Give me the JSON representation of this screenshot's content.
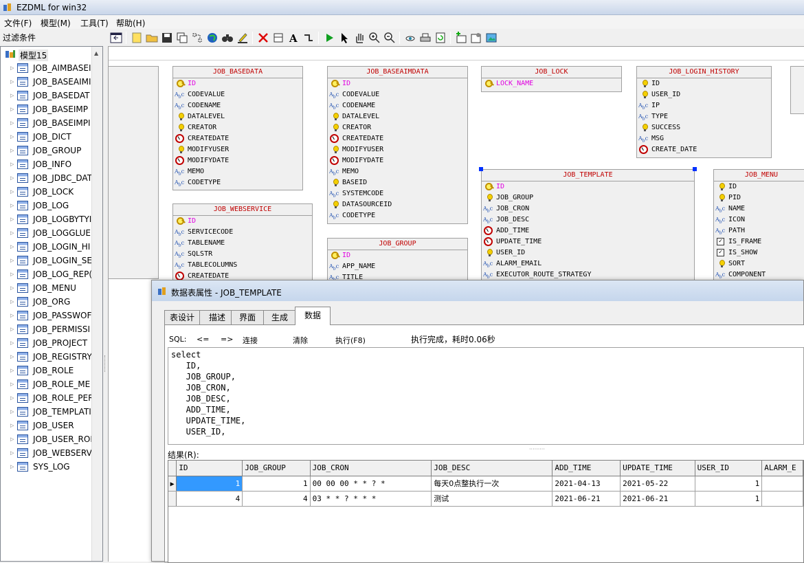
{
  "window": {
    "title": "EZDML for win32"
  },
  "menu": [
    "文件(F)",
    "模型(M)",
    "工具(T)",
    "帮助(H)"
  ],
  "sidebar": {
    "filter_label": "过滤条件",
    "root": "模型15",
    "items": [
      "JOB_AIMBASEI",
      "JOB_BASEAIMI",
      "JOB_BASEDAT",
      "JOB_BASEIMP",
      "JOB_BASEIMPI",
      "JOB_DICT",
      "JOB_GROUP",
      "JOB_INFO",
      "JOB_JDBC_DAT",
      "JOB_LOCK",
      "JOB_LOG",
      "JOB_LOGBYTYI",
      "JOB_LOGGLUE",
      "JOB_LOGIN_HI",
      "JOB_LOGIN_SE",
      "JOB_LOG_REP(",
      "JOB_MENU",
      "JOB_ORG",
      "JOB_PASSWOF",
      "JOB_PERMISSI",
      "JOB_PROJECT",
      "JOB_REGISTRY",
      "JOB_ROLE",
      "JOB_ROLE_ME",
      "JOB_ROLE_PER",
      "JOB_TEMPLATI",
      "JOB_USER",
      "JOB_USER_ROI",
      "JOB_WEBSERV",
      "SYS_LOG"
    ]
  },
  "entities": {
    "basedata": {
      "name": "JOB_BASEDATA",
      "fields": [
        "ID",
        "CODEVALUE",
        "CODENAME",
        "DATALEVEL",
        "CREATOR",
        "CREATEDATE",
        "MODIFYUSER",
        "MODIFYDATE",
        "MEMO",
        "CODETYPE"
      ]
    },
    "baseaimdata": {
      "name": "JOB_BASEAIMDATA",
      "fields": [
        "ID",
        "CODEVALUE",
        "CODENAME",
        "DATALEVEL",
        "CREATOR",
        "CREATEDATE",
        "MODIFYUSER",
        "MODIFYDATE",
        "MEMO",
        "BASEID",
        "SYSTEMCODE",
        "DATASOURCEID",
        "CODETYPE"
      ]
    },
    "lock": {
      "name": "JOB_LOCK",
      "fields": [
        "LOCK_NAME"
      ]
    },
    "login_history": {
      "name": "JOB_LOGIN_HISTORY",
      "fields": [
        "ID",
        "USER_ID",
        "IP",
        "TYPE",
        "SUCCESS",
        "MSG",
        "CREATE_DATE"
      ]
    },
    "webservice": {
      "name": "JOB_WEBSERVICE",
      "fields": [
        "ID",
        "SERVICECODE",
        "TABLENAME",
        "SQLSTR",
        "TABLECOLUMNS",
        "CREATEDATE"
      ]
    },
    "group": {
      "name": "JOB_GROUP",
      "fields": [
        "ID",
        "APP_NAME",
        "TITLE"
      ]
    },
    "template": {
      "name": "JOB_TEMPLATE",
      "fields": [
        "ID",
        "JOB_GROUP",
        "JOB_CRON",
        "JOB_DESC",
        "ADD_TIME",
        "UPDATE_TIME",
        "USER_ID",
        "ALARM_EMAIL",
        "EXECUTOR_ROUTE_STRATEGY"
      ]
    },
    "menu": {
      "name": "JOB_MENU",
      "fields": [
        "ID",
        "PID",
        "NAME",
        "ICON",
        "PATH",
        "IS_FRAME",
        "IS_SHOW",
        "SORT",
        "COMPONENT"
      ]
    }
  },
  "dialog": {
    "title": "数据表属性 - JOB_TEMPLATE",
    "tabs": [
      "表设计",
      "描述",
      "界面",
      "生成",
      "数据"
    ],
    "active_tab": "数据",
    "sql_label": "SQL:",
    "prev_label": "<=",
    "next_label": "=>",
    "connect_label": "连接",
    "clear_label": "清除",
    "execute_label": "执行(F8)",
    "status": "执行完成，耗时0.06秒",
    "sql_text": "select\n   ID,\n   JOB_GROUP,\n   JOB_CRON,\n   JOB_DESC,\n   ADD_TIME,\n   UPDATE_TIME,\n   USER_ID,",
    "result_label": "结果(R):",
    "columns": [
      "ID",
      "JOB_GROUP",
      "JOB_CRON",
      "JOB_DESC",
      "ADD_TIME",
      "UPDATE_TIME",
      "USER_ID",
      "ALARM_E"
    ],
    "rows": [
      [
        "1",
        "1",
        "00 00 00 * * ? *",
        "每天0点整执行一次",
        "2021-04-13",
        "2021-05-22",
        "1",
        ""
      ],
      [
        "4",
        "4",
        "03 * * ? * * *",
        "测试",
        "2021-06-21",
        "2021-06-21",
        "1",
        ""
      ]
    ]
  }
}
